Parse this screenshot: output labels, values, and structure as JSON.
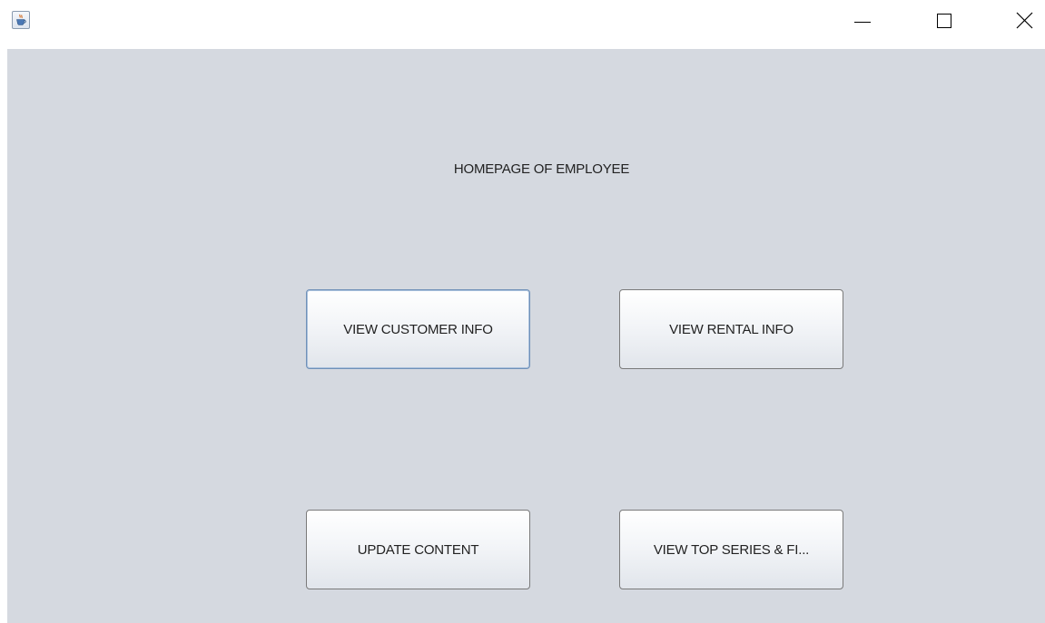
{
  "window": {
    "app_icon": "java-coffee-cup-icon",
    "controls": {
      "minimize_icon": "minimize-icon",
      "maximize_icon": "maximize-icon",
      "close_icon": "close-icon"
    }
  },
  "main": {
    "title": "HOMEPAGE OF EMPLOYEE",
    "buttons": {
      "view_customer_info": "VIEW CUSTOMER INFO",
      "view_rental_info": "VIEW RENTAL INFO",
      "update_content": "UPDATE CONTENT",
      "view_top_series": "VIEW TOP SERIES & FI..."
    }
  },
  "colors": {
    "panel_background": "#d5d9e0",
    "titlebar_background": "#ffffff",
    "focus_border": "#6f90b8"
  }
}
